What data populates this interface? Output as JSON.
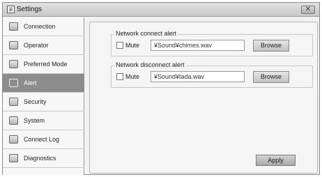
{
  "window": {
    "title": "Settings",
    "close_symbol": "✕"
  },
  "sidebar": {
    "items": [
      {
        "label": "Connection",
        "icon": "connection-icon",
        "active": false
      },
      {
        "label": "Operator",
        "icon": "operator-icon",
        "active": false
      },
      {
        "label": "Preferred Mode",
        "icon": "preferred-mode-icon",
        "active": false
      },
      {
        "label": "Alert",
        "icon": "speaker-icon",
        "active": true
      },
      {
        "label": "Security",
        "icon": "lock-icon",
        "active": false
      },
      {
        "label": "System",
        "icon": "system-icon",
        "active": false
      },
      {
        "label": "Connect Log",
        "icon": "log-icon",
        "active": false
      },
      {
        "label": "Diagnostics",
        "icon": "diagnostics-icon",
        "active": false
      }
    ]
  },
  "alerts": {
    "connect": {
      "title": "Network connect alert",
      "mute_label": "Mute",
      "mute_checked": false,
      "path": "¥Sound¥chimes.wav",
      "browse_label": "Browse"
    },
    "disconnect": {
      "title": "Network disconnect alert",
      "mute_label": "Mute",
      "mute_checked": false,
      "path": "¥Sound¥tada.wav",
      "browse_label": "Browse"
    }
  },
  "footer": {
    "apply_label": "Apply"
  }
}
